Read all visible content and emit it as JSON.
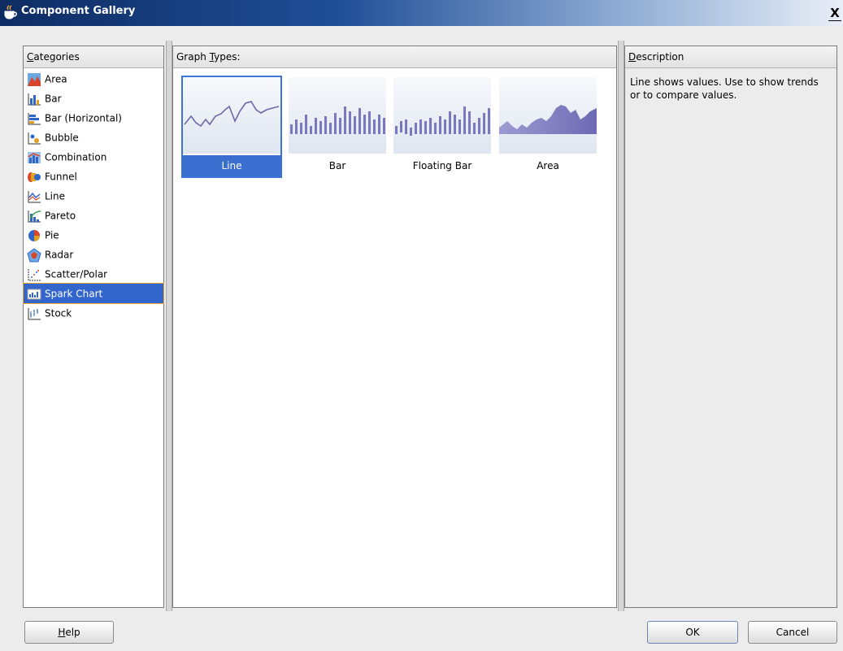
{
  "window": {
    "title": "Component Gallery",
    "close_label": "X"
  },
  "categories": {
    "header_prefix": "C",
    "header_rest": "ategories",
    "items": [
      {
        "label": "Area",
        "icon": "area-chart-icon"
      },
      {
        "label": "Bar",
        "icon": "bar-chart-icon"
      },
      {
        "label": "Bar (Horizontal)",
        "icon": "horizontal-bar-chart-icon"
      },
      {
        "label": "Bubble",
        "icon": "bubble-chart-icon"
      },
      {
        "label": "Combination",
        "icon": "combination-chart-icon"
      },
      {
        "label": "Funnel",
        "icon": "funnel-chart-icon"
      },
      {
        "label": "Line",
        "icon": "line-chart-icon"
      },
      {
        "label": "Pareto",
        "icon": "pareto-chart-icon"
      },
      {
        "label": "Pie",
        "icon": "pie-chart-icon"
      },
      {
        "label": "Radar",
        "icon": "radar-chart-icon"
      },
      {
        "label": "Scatter/Polar",
        "icon": "scatter-chart-icon"
      },
      {
        "label": "Spark Chart",
        "icon": "spark-chart-icon",
        "selected": true
      },
      {
        "label": "Stock",
        "icon": "stock-chart-icon"
      }
    ]
  },
  "graph_types": {
    "header_prefix": "Graph ",
    "header_mnemonic": "T",
    "header_rest": "ypes:",
    "tiles": [
      {
        "label": "Line",
        "selected": true
      },
      {
        "label": "Bar"
      },
      {
        "label": "Floating Bar"
      },
      {
        "label": "Area"
      }
    ]
  },
  "description": {
    "header_prefix": "D",
    "header_rest": "escription",
    "text": "Line shows values. Use to show trends or to compare values."
  },
  "buttons": {
    "help_mnemonic": "H",
    "help_rest": "elp",
    "ok": "OK",
    "cancel": "Cancel"
  },
  "colors": {
    "selection": "#3366cc",
    "selection_outline": "#e8a230",
    "spark_fill": "#7b78c0"
  }
}
